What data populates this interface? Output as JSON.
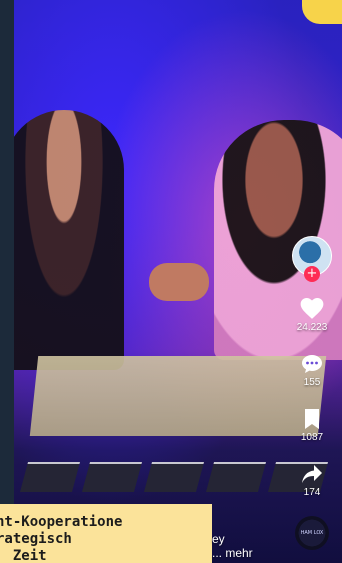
{
  "video": {
    "caption_lines": [
      "ht-Kooperatione",
      "rategisch",
      "  Zeit "
    ],
    "description_lines": [
      "ey",
      "... mehr"
    ]
  },
  "actions": {
    "likes": "24.223",
    "comments": "155",
    "saves": "1087",
    "shares": "174",
    "follow_symbol": "+",
    "music_disc_text": "HAM LOX"
  },
  "colors": {
    "follow": "#fe2c55",
    "caption_bg": "#fbe39a",
    "accent_yellow": "#f7d34a"
  }
}
